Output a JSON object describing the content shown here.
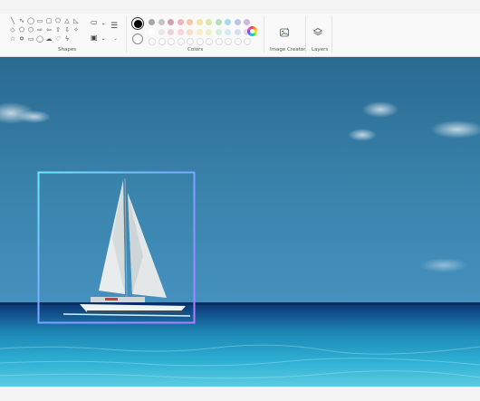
{
  "ribbon": {
    "groups": {
      "shapes_label": "Shapes",
      "colors_label": "Colors",
      "image_creator_label": "Image Creator",
      "layers_label": "Layers"
    },
    "shape_icons": [
      "line-shape-icon",
      "curve-shape-icon",
      "oval-shape-icon",
      "rectangle-shape-icon",
      "rounded-rectangle-shape-icon",
      "polygon-shape-icon",
      "triangle-shape-icon",
      "right-triangle-shape-icon",
      "diamond-shape-icon",
      "pentagon-shape-icon",
      "hexagon-shape-icon",
      "right-arrow-shape-icon",
      "left-arrow-shape-icon",
      "up-arrow-shape-icon",
      "down-arrow-shape-icon",
      "four-point-star-shape-icon",
      "five-point-star-shape-icon",
      "six-point-star-shape-icon",
      "callout-rect-shape-icon",
      "callout-oval-shape-icon",
      "callout-cloud-shape-icon",
      "heart-shape-icon",
      "lightning-shape-icon"
    ],
    "tool_icons": [
      "outline-style-icon",
      "fill-style-icon",
      "size-lines-icon"
    ],
    "primary_color": "#000000",
    "secondary_color": "#ffffff",
    "palette_row1": [
      "#a7a7a7",
      "#c3c3c3",
      "#d1a1ad",
      "#f0b3b9",
      "#f7c6a3",
      "#f4e4a0",
      "#d9eaa3",
      "#b2e0b9",
      "#a9d8ee",
      "#b9c3e5",
      "#cdb6e0"
    ],
    "palette_row2": [
      "#ffffff",
      "#e6e6e6",
      "#e8d3d9",
      "#f6d5d8",
      "#f9dfca",
      "#f7eec6",
      "#e9f2c8",
      "#d4eed9",
      "#d0eaf6",
      "#d8deef",
      "#e4d7ee",
      "#eeeeee"
    ],
    "edit_colors_icon": "color-wheel-icon",
    "image_creator_icon": "image-creator-icon",
    "layers_icon": "layers-icon"
  },
  "canvas": {
    "scene": "sailboat-on-ocean-photo",
    "selection_box": "gradient-selection-frame",
    "colors": {
      "sky_top": "#2c6d94",
      "sky_mid": "#3b86ad",
      "sky_low": "#3f8dbf",
      "horizon": "#0f3d77",
      "sea_near": "#2aa7cc",
      "sea_foam": "#6fd4e8",
      "sail": "#e9ecec",
      "hull": "#eef2f3"
    }
  }
}
